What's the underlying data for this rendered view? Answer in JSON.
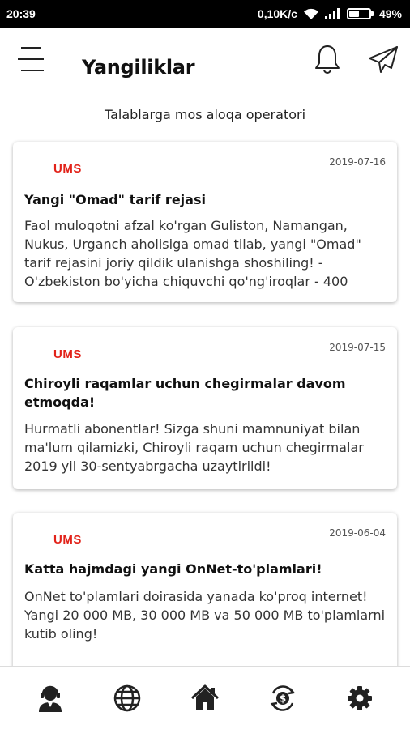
{
  "status_bar": {
    "time": "20:39",
    "network_speed": "0,10K/c",
    "battery_percent": "49%",
    "battery_level": 0.49
  },
  "header": {
    "menu_icon": "hamburger-menu-icon",
    "title": "Yangiliklar",
    "notification_icon": "bell-icon",
    "send_icon": "paper-plane-icon"
  },
  "subtitle": "Talablarga mos aloqa operatori",
  "news": [
    {
      "logo": "UMS",
      "date": "2019-07-16",
      "title": "Yangi \"Omad\" tarif rejasi",
      "body": "Faol muloqotni afzal ko'rgan Guliston, Namangan, Nukus, Urganch aholisiga omad tilab, yangi \"Omad\" tarif rejasini joriy qildik ulanishga shoshiling! - O'zbekiston bo'yicha chiquvchi qo'ng'iroqlar - 400"
    },
    {
      "logo": "UMS",
      "date": "2019-07-15",
      "title": "Chiroyli raqamlar uchun chegirmalar davom etmoqda!",
      "body": "Hurmatli abonentlar! Sizga shuni mamnuniyat bilan ma'lum qilamizki, Chiroyli raqam uchun chegirmalar 2019 yil 30-sentyabrgacha uzaytirildi!"
    },
    {
      "logo": "UMS",
      "date": "2019-06-04",
      "title": "Katta hajmdagi yangi OnNet-to'plamlari!",
      "body": "OnNet to'plamlari doirasida yanada ko'proq internet! Yangi 20 000 MB, 30 000 MB va 50 000 MB to'plamlarni kutib oling!"
    }
  ],
  "bottom_nav": [
    {
      "icon": "user-headset-icon"
    },
    {
      "icon": "globe-icon"
    },
    {
      "icon": "home-icon"
    },
    {
      "icon": "currency-exchange-icon"
    },
    {
      "icon": "gear-icon"
    }
  ],
  "colors": {
    "brand_red": "#e2231a",
    "status_bar": "#000000",
    "icon_dark": "#222222"
  }
}
